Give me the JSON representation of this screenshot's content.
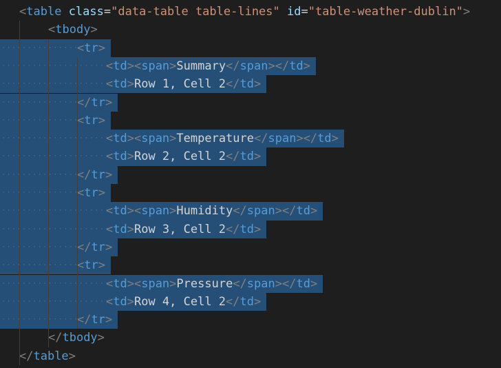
{
  "editor": {
    "lines": [
      {
        "indent": 0,
        "tokens": [
          {
            "t": "<",
            "c": "tk-punc"
          },
          {
            "t": "table",
            "c": "tk-tag"
          },
          {
            "t": " ",
            "c": "tk-text"
          },
          {
            "t": "class",
            "c": "tk-attr"
          },
          {
            "t": "=",
            "c": "tk-eq"
          },
          {
            "t": "\"data-table table-lines\"",
            "c": "tk-str"
          },
          {
            "t": " ",
            "c": "tk-text"
          },
          {
            "t": "id",
            "c": "tk-attr"
          },
          {
            "t": "=",
            "c": "tk-eq"
          },
          {
            "t": "\"table-weather-dublin\"",
            "c": "tk-str"
          },
          {
            "t": ">",
            "c": "tk-punc"
          }
        ]
      },
      {
        "indent": 1,
        "tokens": [
          {
            "t": "<",
            "c": "tk-punc"
          },
          {
            "t": "tbody",
            "c": "tk-tag"
          },
          {
            "t": ">",
            "c": "tk-punc"
          }
        ]
      },
      {
        "indent": 2,
        "tokens": [
          {
            "t": "<",
            "c": "tk-punc"
          },
          {
            "t": "tr",
            "c": "tk-tag"
          },
          {
            "t": ">",
            "c": "tk-punc"
          }
        ]
      },
      {
        "indent": 3,
        "tokens": [
          {
            "t": "<",
            "c": "tk-punc"
          },
          {
            "t": "td",
            "c": "tk-tag"
          },
          {
            "t": "><",
            "c": "tk-punc"
          },
          {
            "t": "span",
            "c": "tk-tag"
          },
          {
            "t": ">",
            "c": "tk-punc"
          },
          {
            "t": "Summary",
            "c": "tk-text"
          },
          {
            "t": "</",
            "c": "tk-punc"
          },
          {
            "t": "span",
            "c": "tk-tag"
          },
          {
            "t": "></",
            "c": "tk-punc"
          },
          {
            "t": "td",
            "c": "tk-tag"
          },
          {
            "t": ">",
            "c": "tk-punc"
          }
        ]
      },
      {
        "indent": 3,
        "tokens": [
          {
            "t": "<",
            "c": "tk-punc"
          },
          {
            "t": "td",
            "c": "tk-tag"
          },
          {
            "t": ">",
            "c": "tk-punc"
          },
          {
            "t": "Row 1, Cell 2",
            "c": "tk-text"
          },
          {
            "t": "</",
            "c": "tk-punc"
          },
          {
            "t": "td",
            "c": "tk-tag"
          },
          {
            "t": ">",
            "c": "tk-punc"
          }
        ]
      },
      {
        "indent": 2,
        "tokens": [
          {
            "t": "</",
            "c": "tk-punc"
          },
          {
            "t": "tr",
            "c": "tk-tag"
          },
          {
            "t": ">",
            "c": "tk-punc"
          }
        ]
      },
      {
        "indent": 2,
        "tokens": [
          {
            "t": "<",
            "c": "tk-punc"
          },
          {
            "t": "tr",
            "c": "tk-tag"
          },
          {
            "t": ">",
            "c": "tk-punc"
          }
        ]
      },
      {
        "indent": 3,
        "tokens": [
          {
            "t": "<",
            "c": "tk-punc"
          },
          {
            "t": "td",
            "c": "tk-tag"
          },
          {
            "t": "><",
            "c": "tk-punc"
          },
          {
            "t": "span",
            "c": "tk-tag"
          },
          {
            "t": ">",
            "c": "tk-punc"
          },
          {
            "t": "Temperature",
            "c": "tk-text"
          },
          {
            "t": "</",
            "c": "tk-punc"
          },
          {
            "t": "span",
            "c": "tk-tag"
          },
          {
            "t": "></",
            "c": "tk-punc"
          },
          {
            "t": "td",
            "c": "tk-tag"
          },
          {
            "t": ">",
            "c": "tk-punc"
          }
        ]
      },
      {
        "indent": 3,
        "tokens": [
          {
            "t": "<",
            "c": "tk-punc"
          },
          {
            "t": "td",
            "c": "tk-tag"
          },
          {
            "t": ">",
            "c": "tk-punc"
          },
          {
            "t": "Row 2, Cell 2",
            "c": "tk-text"
          },
          {
            "t": "</",
            "c": "tk-punc"
          },
          {
            "t": "td",
            "c": "tk-tag"
          },
          {
            "t": ">",
            "c": "tk-punc"
          }
        ]
      },
      {
        "indent": 2,
        "tokens": [
          {
            "t": "</",
            "c": "tk-punc"
          },
          {
            "t": "tr",
            "c": "tk-tag"
          },
          {
            "t": ">",
            "c": "tk-punc"
          }
        ]
      },
      {
        "indent": 2,
        "tokens": [
          {
            "t": "<",
            "c": "tk-punc"
          },
          {
            "t": "tr",
            "c": "tk-tag"
          },
          {
            "t": ">",
            "c": "tk-punc"
          }
        ]
      },
      {
        "indent": 3,
        "tokens": [
          {
            "t": "<",
            "c": "tk-punc"
          },
          {
            "t": "td",
            "c": "tk-tag"
          },
          {
            "t": "><",
            "c": "tk-punc"
          },
          {
            "t": "span",
            "c": "tk-tag"
          },
          {
            "t": ">",
            "c": "tk-punc"
          },
          {
            "t": "Humidity",
            "c": "tk-text"
          },
          {
            "t": "</",
            "c": "tk-punc"
          },
          {
            "t": "span",
            "c": "tk-tag"
          },
          {
            "t": "></",
            "c": "tk-punc"
          },
          {
            "t": "td",
            "c": "tk-tag"
          },
          {
            "t": ">",
            "c": "tk-punc"
          }
        ]
      },
      {
        "indent": 3,
        "tokens": [
          {
            "t": "<",
            "c": "tk-punc"
          },
          {
            "t": "td",
            "c": "tk-tag"
          },
          {
            "t": ">",
            "c": "tk-punc"
          },
          {
            "t": "Row 3, Cell 2",
            "c": "tk-text"
          },
          {
            "t": "</",
            "c": "tk-punc"
          },
          {
            "t": "td",
            "c": "tk-tag"
          },
          {
            "t": ">",
            "c": "tk-punc"
          }
        ]
      },
      {
        "indent": 2,
        "tokens": [
          {
            "t": "</",
            "c": "tk-punc"
          },
          {
            "t": "tr",
            "c": "tk-tag"
          },
          {
            "t": ">",
            "c": "tk-punc"
          }
        ]
      },
      {
        "indent": 2,
        "tokens": [
          {
            "t": "<",
            "c": "tk-punc"
          },
          {
            "t": "tr",
            "c": "tk-tag"
          },
          {
            "t": ">",
            "c": "tk-punc"
          }
        ]
      },
      {
        "indent": 3,
        "tokens": [
          {
            "t": "<",
            "c": "tk-punc"
          },
          {
            "t": "td",
            "c": "tk-tag"
          },
          {
            "t": "><",
            "c": "tk-punc"
          },
          {
            "t": "span",
            "c": "tk-tag"
          },
          {
            "t": ">",
            "c": "tk-punc"
          },
          {
            "t": "Pressure",
            "c": "tk-text"
          },
          {
            "t": "</",
            "c": "tk-punc"
          },
          {
            "t": "span",
            "c": "tk-tag"
          },
          {
            "t": "></",
            "c": "tk-punc"
          },
          {
            "t": "td",
            "c": "tk-tag"
          },
          {
            "t": ">",
            "c": "tk-punc"
          }
        ]
      },
      {
        "indent": 3,
        "tokens": [
          {
            "t": "<",
            "c": "tk-punc"
          },
          {
            "t": "td",
            "c": "tk-tag"
          },
          {
            "t": ">",
            "c": "tk-punc"
          },
          {
            "t": "Row 4, Cell 2",
            "c": "tk-text"
          },
          {
            "t": "</",
            "c": "tk-punc"
          },
          {
            "t": "td",
            "c": "tk-tag"
          },
          {
            "t": ">",
            "c": "tk-punc"
          }
        ]
      },
      {
        "indent": 2,
        "tokens": [
          {
            "t": "</",
            "c": "tk-punc"
          },
          {
            "t": "tr",
            "c": "tk-tag"
          },
          {
            "t": ">",
            "c": "tk-punc"
          }
        ]
      },
      {
        "indent": 1,
        "tokens": [
          {
            "t": "</",
            "c": "tk-punc"
          },
          {
            "t": "tbody",
            "c": "tk-tag"
          },
          {
            "t": ">",
            "c": "tk-punc"
          }
        ]
      },
      {
        "indent": 0,
        "tokens": [
          {
            "t": "</",
            "c": "tk-punc"
          },
          {
            "t": "table",
            "c": "tk-tag"
          },
          {
            "t": ">",
            "c": "tk-punc"
          }
        ]
      }
    ],
    "selection": {
      "first_line": 3,
      "last_line": 18
    },
    "colors": {
      "background": "#1e1e1e",
      "selection": "#264f78",
      "tag": "#569cd6",
      "attribute": "#9cdcfe",
      "string": "#ce9178",
      "punctuation": "#808080",
      "text": "#d4d4d4"
    }
  }
}
